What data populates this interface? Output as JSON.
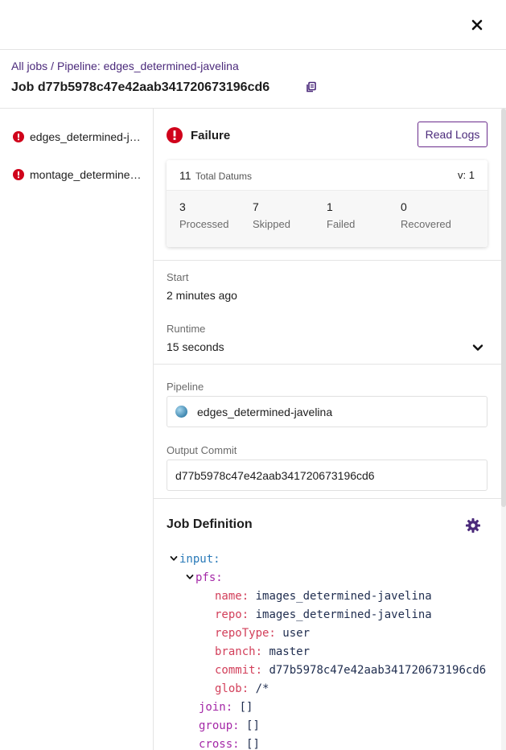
{
  "breadcrumb": {
    "all_jobs": "All jobs",
    "separator": "/",
    "pipeline": "Pipeline: edges_determined-javelina"
  },
  "job": {
    "title": "Job d77b5978c47e42aab341720673196cd6"
  },
  "sidebar": {
    "items": [
      {
        "label": "edges_determined-javelina",
        "status": "error"
      },
      {
        "label": "montage_determined-javelina",
        "status": "error"
      }
    ]
  },
  "status": {
    "text": "Failure",
    "read_logs": "Read Logs"
  },
  "datums": {
    "total": "11",
    "total_label": "Total Datums",
    "version": "v: 1",
    "stats": [
      {
        "num": "3",
        "label": "Processed"
      },
      {
        "num": "7",
        "label": "Skipped"
      },
      {
        "num": "1",
        "label": "Failed"
      },
      {
        "num": "0",
        "label": "Recovered"
      }
    ]
  },
  "details": {
    "start_label": "Start",
    "start_value": "2 minutes ago",
    "runtime_label": "Runtime",
    "runtime_value": "15 seconds",
    "pipeline_label": "Pipeline",
    "pipeline_value": "edges_determined-javelina",
    "output_label": "Output Commit",
    "output_value": "d77b5978c47e42aab341720673196cd6"
  },
  "definition": {
    "title": "Job Definition",
    "lines": {
      "input_key": "input:",
      "pfs_key": "pfs:",
      "name_key": "name:",
      "name_val": "images_determined-javelina",
      "repo_key": "repo:",
      "repo_val": "images_determined-javelina",
      "repotype_key": "repoType:",
      "repotype_val": "user",
      "branch_key": "branch:",
      "branch_val": "master",
      "commit_key": "commit:",
      "commit_val": "d77b5978c47e42aab341720673196cd6",
      "glob_key": "glob:",
      "glob_val": "/*",
      "join_key": "join:",
      "join_val": "[]",
      "group_key": "group:",
      "group_val": "[]",
      "cross_key": "cross:",
      "cross_val": "[]"
    }
  },
  "colors": {
    "accent": "#4b2a7b",
    "error": "#d0021b"
  }
}
